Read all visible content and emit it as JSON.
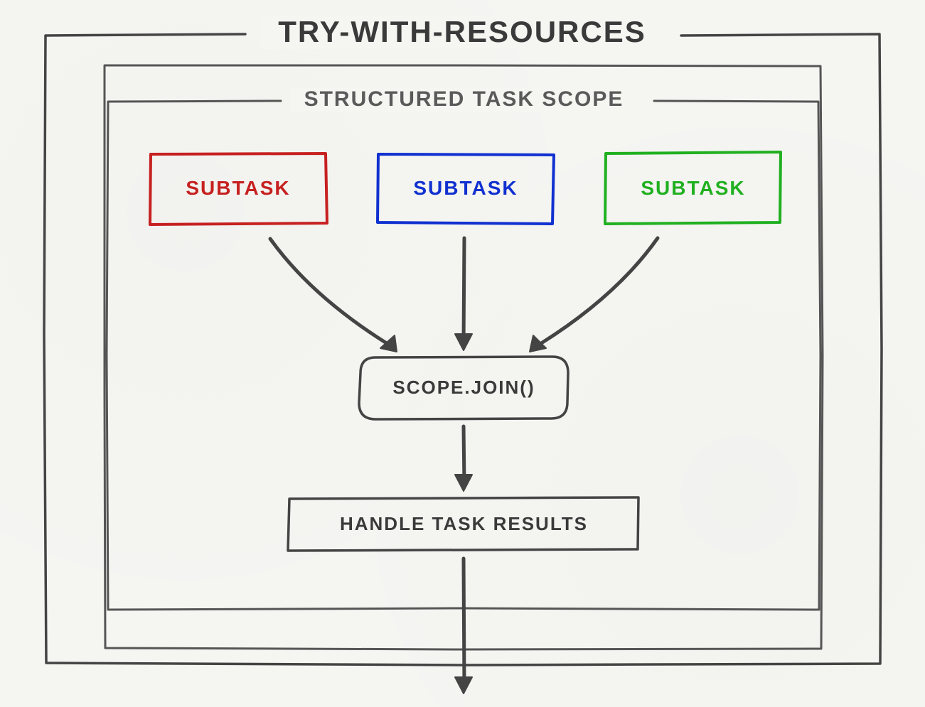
{
  "diagram": {
    "outer_title": "TRY-WITH-RESOURCES",
    "scope_title": "STRUCTURED TASK SCOPE",
    "subtasks": [
      {
        "label": "SUBTASK",
        "color": "#c62020"
      },
      {
        "label": "SUBTASK",
        "color": "#1030d0"
      },
      {
        "label": "SUBTASK",
        "color": "#20b020"
      }
    ],
    "join_label": "SCOPE.JOIN()",
    "results_label": "HANDLE TASK RESULTS"
  }
}
